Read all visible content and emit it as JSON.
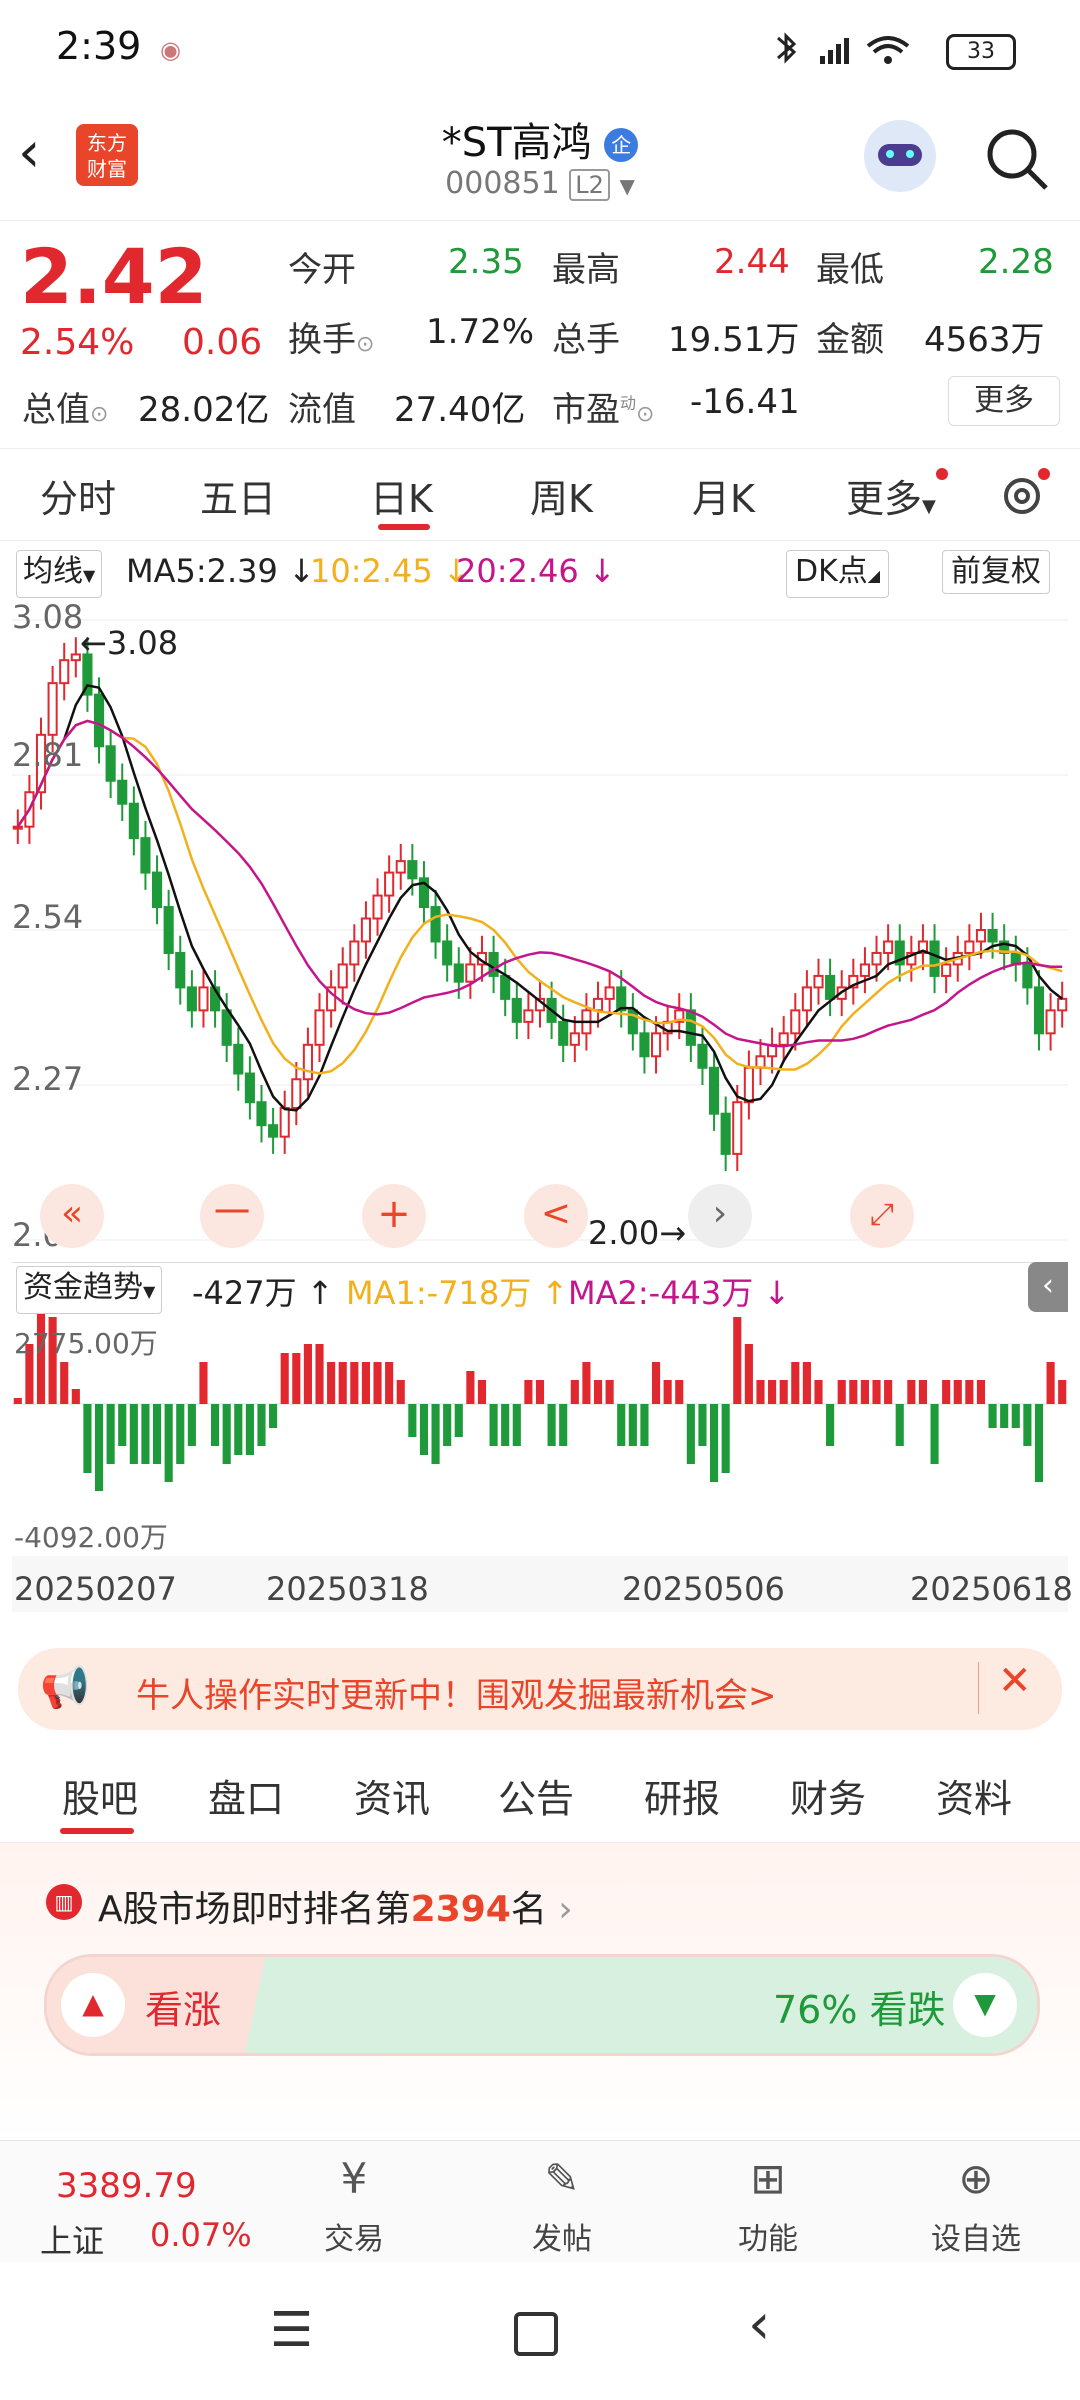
{
  "status_bar": {
    "time": "2:39",
    "battery": "33"
  },
  "header": {
    "logo_line1": "东方",
    "logo_line2": "财富",
    "title": "*ST高鸿",
    "badge": "企",
    "code": "000851",
    "level": "L2"
  },
  "quote": {
    "price": "2.42",
    "change_pct": "2.54%",
    "change": "0.06",
    "open_label": "今开",
    "open": "2.35",
    "high_label": "最高",
    "high": "2.44",
    "low_label": "最低",
    "low": "2.28",
    "turnover_label": "换手",
    "turnover": "1.72%",
    "volume_label": "总手",
    "volume": "19.51万",
    "amount_label": "金额",
    "amount": "4563万",
    "mktcap_label": "总值",
    "mktcap": "28.02亿",
    "float_label": "流值",
    "float": "27.40亿",
    "pe_label": "市盈",
    "pe_sup": "动",
    "pe": "-16.41",
    "more_button": "更多"
  },
  "tabs": [
    "分时",
    "五日",
    "日K",
    "周K",
    "月K",
    "更多"
  ],
  "active_tab": "日K",
  "indicator_bar": {
    "ma_select": "均线",
    "ma5": "MA5:2.39 ↓",
    "ma10": "10:2.45 ↓",
    "ma20": "20:2.46 ↓",
    "dk": "DK点",
    "adjust": "前复权"
  },
  "colors": {
    "up": "#e0282e",
    "down": "#1f9a3a",
    "ma5": "#111111",
    "ma10": "#f2b01d",
    "ma20": "#c4158a",
    "accent": "#e8452a"
  },
  "chart_data": {
    "type": "candlestick",
    "y_ticks": [
      "3.08",
      "2.81",
      "2.54",
      "2.27",
      "2.00"
    ],
    "ylim": [
      2.0,
      3.08
    ],
    "max_label": "3.08",
    "min_label": "2.00",
    "x_ticks": [
      "20250207",
      "20250318",
      "20250506",
      "20250618"
    ],
    "closes": [
      2.72,
      2.78,
      2.88,
      2.97,
      3.01,
      3.02,
      2.95,
      2.86,
      2.8,
      2.76,
      2.7,
      2.64,
      2.58,
      2.5,
      2.44,
      2.4,
      2.44,
      2.4,
      2.34,
      2.29,
      2.24,
      2.2,
      2.18,
      2.23,
      2.28,
      2.34,
      2.4,
      2.44,
      2.48,
      2.52,
      2.56,
      2.6,
      2.64,
      2.66,
      2.63,
      2.58,
      2.52,
      2.48,
      2.45,
      2.48,
      2.5,
      2.46,
      2.42,
      2.38,
      2.4,
      2.42,
      2.38,
      2.34,
      2.36,
      2.4,
      2.42,
      2.44,
      2.4,
      2.36,
      2.32,
      2.36,
      2.38,
      2.4,
      2.34,
      2.3,
      2.22,
      2.15,
      2.24,
      2.3,
      2.32,
      2.34,
      2.36,
      2.4,
      2.44,
      2.46,
      2.42,
      2.44,
      2.46,
      2.48,
      2.5,
      2.52,
      2.48,
      2.5,
      2.52,
      2.46,
      2.48,
      2.5,
      2.52,
      2.54,
      2.52,
      2.5,
      2.48,
      2.44,
      2.36,
      2.4,
      2.42
    ],
    "capital_flow": {
      "label": "资金趋势",
      "value": "-427万 ↑",
      "ma1": "MA1:-718万 ↑",
      "ma2": "MA2:-443万 ↓",
      "y_ticks": [
        "2775.00万",
        "-4092.00万"
      ]
    }
  },
  "chart_controls": {
    "minus": "一",
    "plus": "+",
    "prev": "<"
  },
  "promo": {
    "text": "牛人操作实时更新中！围观发掘最新机会>"
  },
  "subtabs": [
    "股吧",
    "盘口",
    "资讯",
    "公告",
    "研报",
    "财务",
    "资料"
  ],
  "active_subtab": "股吧",
  "ranking": {
    "prefix": "A股市场即时排名第",
    "rank": "2394",
    "suffix": "名"
  },
  "sentiment": {
    "up_label": "看涨",
    "down_label": "76% 看跌",
    "down_pct": 76
  },
  "bottom_bar": {
    "index_value": "3389.79",
    "index_name": "上证",
    "index_change": "0.07%",
    "items": [
      "交易",
      "发帖",
      "功能",
      "设自选"
    ]
  }
}
